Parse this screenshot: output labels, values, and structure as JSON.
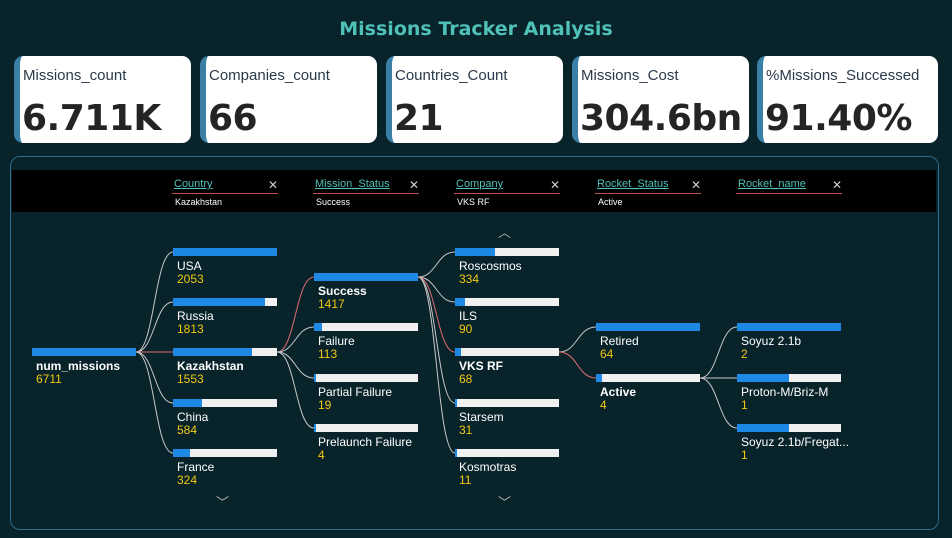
{
  "title": "Missions Tracker Analysis",
  "kpis": [
    {
      "label": "Missions_count",
      "value": "6.711K"
    },
    {
      "label": "Companies_count",
      "value": "66"
    },
    {
      "label": "Countries_Count",
      "value": "21"
    },
    {
      "label": "Missions_Cost",
      "value": "304.6bn"
    },
    {
      "label": "%Missions_Successed",
      "value": "91.40%"
    }
  ],
  "breadcrumbs": [
    {
      "field": "Country",
      "value": "Kazakhstan"
    },
    {
      "field": "Mission_Status",
      "value": "Success"
    },
    {
      "field": "Company",
      "value": "VKS RF"
    },
    {
      "field": "Rocket_Status",
      "value": "Active"
    },
    {
      "field": "Rocket_name",
      "value": ""
    }
  ],
  "tree": {
    "root": {
      "label": "num_missions",
      "value": "6711",
      "fill": 1.0
    },
    "country": [
      {
        "label": "USA",
        "value": "2053",
        "fill": 1.0
      },
      {
        "label": "Russia",
        "value": "1813",
        "fill": 0.88
      },
      {
        "label": "Kazakhstan",
        "value": "1553",
        "fill": 0.76,
        "selected": true
      },
      {
        "label": "China",
        "value": "584",
        "fill": 0.28
      },
      {
        "label": "France",
        "value": "324",
        "fill": 0.16
      }
    ],
    "mission_status": [
      {
        "label": "Success",
        "value": "1417",
        "fill": 1.0,
        "selected": true
      },
      {
        "label": "Failure",
        "value": "113",
        "fill": 0.08
      },
      {
        "label": "Partial Failure",
        "value": "19",
        "fill": 0.0
      },
      {
        "label": "Prelaunch Failure",
        "value": "4",
        "fill": 0.0
      }
    ],
    "company": [
      {
        "label": "Roscosmos",
        "value": "334",
        "fill": 0.38
      },
      {
        "label": "ILS",
        "value": "90",
        "fill": 0.1
      },
      {
        "label": "VKS RF",
        "value": "68",
        "fill": 0.06,
        "selected": true
      },
      {
        "label": "Starsem",
        "value": "31",
        "fill": 0.0
      },
      {
        "label": "Kosmotras",
        "value": "11",
        "fill": 0.0
      }
    ],
    "rocket_status": [
      {
        "label": "Retired",
        "value": "64",
        "fill": 1.0
      },
      {
        "label": "Active",
        "value": "4",
        "fill": 0.06,
        "selected": true
      }
    ],
    "rocket_name": [
      {
        "label": "Soyuz 2.1b",
        "value": "2",
        "fill": 1.0
      },
      {
        "label": "Proton-M/Briz-M",
        "value": "1",
        "fill": 0.5
      },
      {
        "label": "Soyuz 2.1b/Fregat...",
        "value": "1",
        "fill": 0.5
      }
    ]
  },
  "colors": {
    "bar_fill": "#1e88e5",
    "bar_bg": "#f0f0f0",
    "value": "#f2c811",
    "accent": "#4fc1b8",
    "selected_link": "#e06c75"
  },
  "icons": {
    "scroll_up": "chevron-up-icon",
    "scroll_down": "chevron-down-icon",
    "remove": "close-icon"
  }
}
